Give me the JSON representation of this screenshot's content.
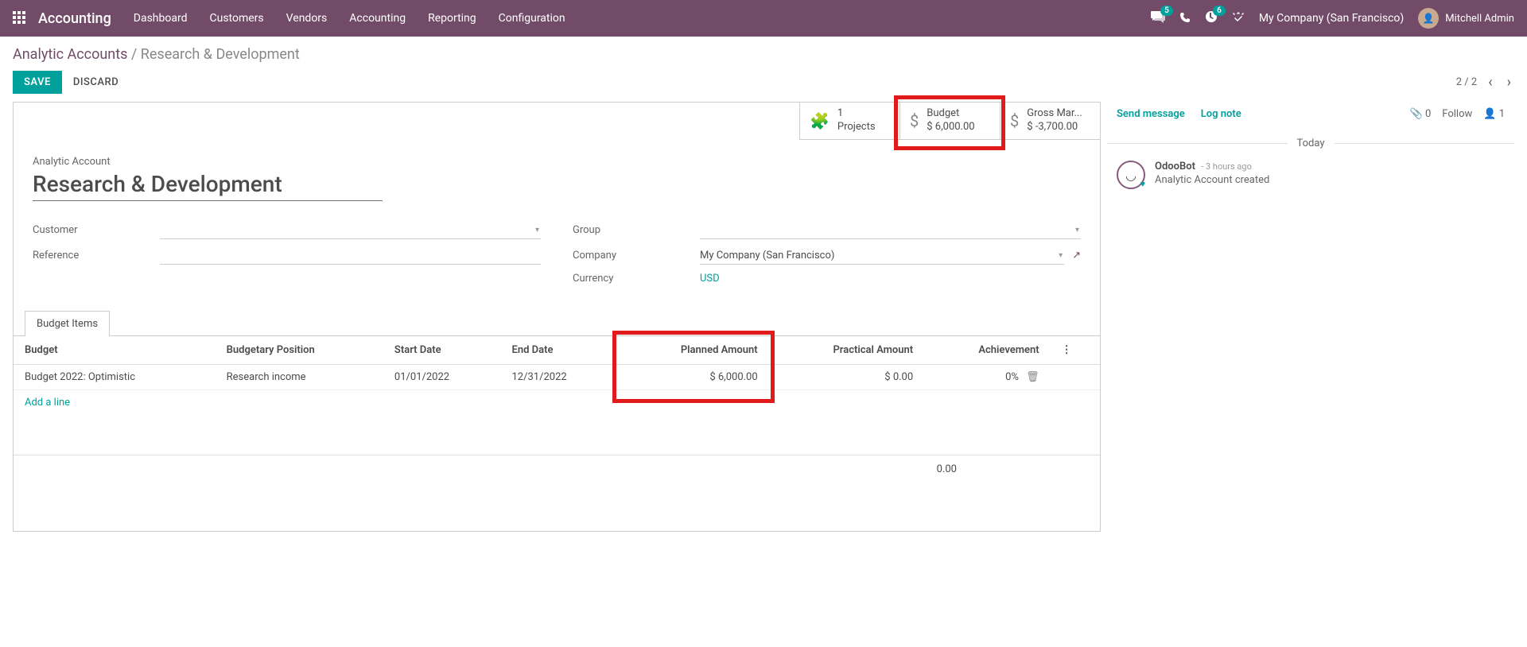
{
  "topnav": {
    "brand": "Accounting",
    "menu": [
      "Dashboard",
      "Customers",
      "Vendors",
      "Accounting",
      "Reporting",
      "Configuration"
    ],
    "msg_badge": "5",
    "clock_badge": "6",
    "company": "My Company (San Francisco)",
    "user": "Mitchell Admin"
  },
  "breadcrumb": {
    "root": "Analytic Accounts",
    "current": "Research & Development"
  },
  "actions": {
    "save": "SAVE",
    "discard": "DISCARD"
  },
  "pager": {
    "text": "2 / 2"
  },
  "stat": {
    "projects": {
      "count": "1",
      "label": "Projects"
    },
    "budget": {
      "label": "Budget",
      "amount": "$ 6,000.00"
    },
    "gross": {
      "label": "Gross Mar...",
      "amount": "$ -3,700.00"
    }
  },
  "form": {
    "title_label": "Analytic Account",
    "title_value": "Research & Development",
    "labels": {
      "customer": "Customer",
      "reference": "Reference",
      "group": "Group",
      "company": "Company",
      "currency": "Currency"
    },
    "company_value": "My Company (San Francisco)",
    "currency_value": "USD"
  },
  "tabs": {
    "budget_items": "Budget Items"
  },
  "table": {
    "headers": {
      "budget": "Budget",
      "position": "Budgetary Position",
      "start": "Start Date",
      "end": "End Date",
      "planned": "Planned Amount",
      "practical": "Practical Amount",
      "achievement": "Achievement"
    },
    "row": {
      "budget": "Budget 2022: Optimistic",
      "position": "Research income",
      "start": "01/01/2022",
      "end": "12/31/2022",
      "planned": "$ 6,000.00",
      "practical": "$ 0.00",
      "achievement": "0%"
    },
    "add_line": "Add a line",
    "footer_total": "0.00"
  },
  "chatter": {
    "send": "Send message",
    "log": "Log note",
    "attach_count": "0",
    "follow": "Follow",
    "follower_count": "1",
    "today": "Today",
    "msg": {
      "author": "OdooBot",
      "time": "- 3 hours ago",
      "text": "Analytic Account created"
    }
  }
}
